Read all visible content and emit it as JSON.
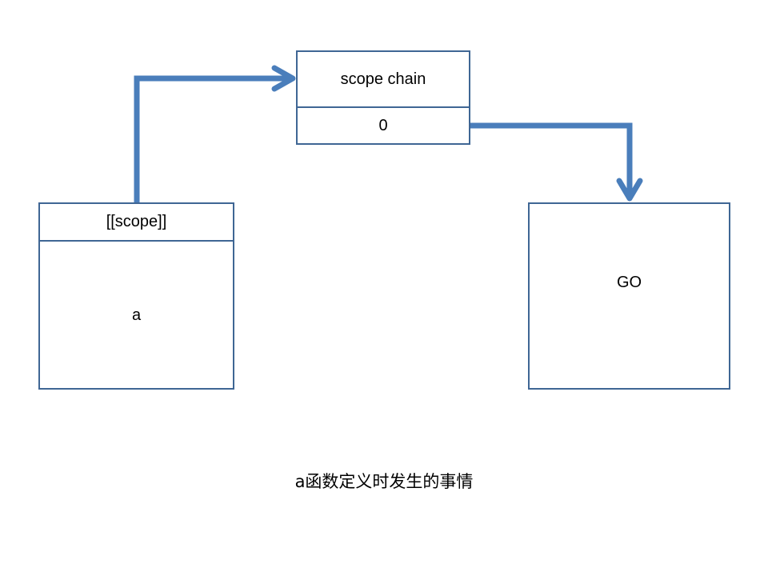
{
  "scope_chain_box": {
    "title": "scope chain",
    "slot_0": "0"
  },
  "function_a_box": {
    "header": "[[scope]]",
    "name": "a"
  },
  "go_box": {
    "label": "GO"
  },
  "caption": "a函数定义时发生的事情",
  "colors": {
    "box_border": "#3F6694",
    "arrow": "#4A7EBB"
  }
}
